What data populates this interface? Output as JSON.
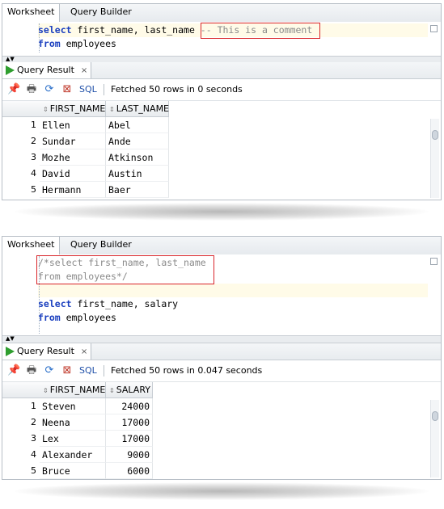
{
  "panel1": {
    "tabs": {
      "worksheet": "Worksheet",
      "query_builder": "Query Builder"
    },
    "code": [
      {
        "kw": "select",
        "rest": " first_name, last_name ",
        "comment": "-- This is a comment"
      },
      {
        "kw": "from",
        "rest": " employees",
        "comment": ""
      }
    ],
    "result": {
      "tab_label": "Query Result",
      "close": "×",
      "sql_label": "SQL",
      "status": "Fetched 50 rows in 0 seconds",
      "columns": [
        "FIRST_NAME",
        "LAST_NAME"
      ],
      "rows": [
        {
          "n": "1",
          "c": [
            "Ellen",
            "Abel"
          ]
        },
        {
          "n": "2",
          "c": [
            "Sundar",
            "Ande"
          ]
        },
        {
          "n": "3",
          "c": [
            "Mozhe",
            "Atkinson"
          ]
        },
        {
          "n": "4",
          "c": [
            "David",
            "Austin"
          ]
        },
        {
          "n": "5",
          "c": [
            "Hermann",
            "Baer"
          ]
        }
      ]
    }
  },
  "panel2": {
    "tabs": {
      "worksheet": "Worksheet",
      "query_builder": "Query Builder"
    },
    "comment_lines": [
      "/*select first_name, last_name",
      "from employees*/"
    ],
    "code": [
      {
        "kw": "select",
        "rest": " first_name, salary"
      },
      {
        "kw": "from",
        "rest": " employees"
      }
    ],
    "result": {
      "tab_label": "Query Result",
      "close": "×",
      "sql_label": "SQL",
      "status": "Fetched 50 rows in 0.047 seconds",
      "columns": [
        "FIRST_NAME",
        "SALARY"
      ],
      "rows": [
        {
          "n": "1",
          "c": [
            "Steven",
            "24000"
          ]
        },
        {
          "n": "2",
          "c": [
            "Neena",
            "17000"
          ]
        },
        {
          "n": "3",
          "c": [
            "Lex",
            "17000"
          ]
        },
        {
          "n": "4",
          "c": [
            "Alexander",
            "9000"
          ]
        },
        {
          "n": "5",
          "c": [
            "Bruce",
            "6000"
          ]
        }
      ]
    }
  },
  "icons": {
    "pin": "pin-icon",
    "print": "print-icon",
    "refresh": "refresh-icon",
    "clear": "clear-icon",
    "play": "play-icon"
  },
  "colors": {
    "keyword": "#1a3fbf",
    "comment": "#8a8a8a",
    "highlight_box": "#d9252a",
    "run_green": "#2f9e2f",
    "sql_link": "#1f4fa8"
  }
}
